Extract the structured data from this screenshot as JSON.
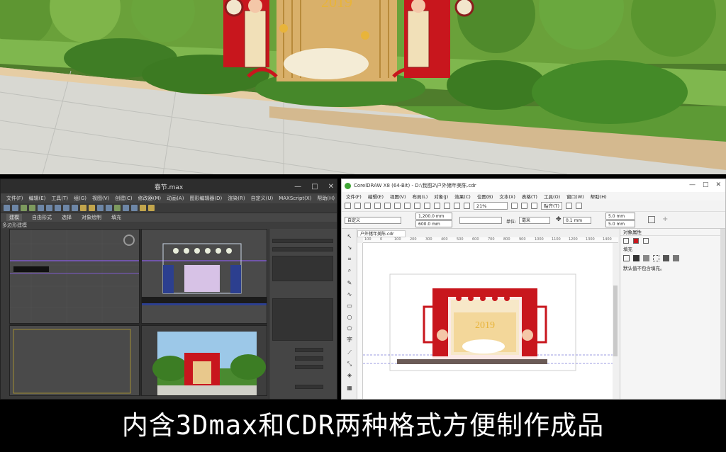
{
  "caption": "内含3Dmax和CDR两种格式方便制作成品",
  "max_window": {
    "title": "春节.max",
    "window_buttons": [
      "—",
      "□",
      "✕"
    ],
    "menu": [
      "文件(F)",
      "编辑(E)",
      "工具(T)",
      "组(G)",
      "视图(V)",
      "创建(C)",
      "修改器(M)",
      "动画(A)",
      "图形编辑器(D)",
      "渲染(R)",
      "自定义(U)",
      "MAXScript(X)",
      "帮助(H)"
    ],
    "ribbon_tabs": [
      "建模",
      "自由形式",
      "选择",
      "对象绘制",
      "填充"
    ],
    "active_ribbon_tab": "建模",
    "sub_label": "多边形建模"
  },
  "cdr_window": {
    "title": "CorelDRAW X8 (64-Bit) - D:\\我图2\\户外猪年美陈.cdr",
    "menu": [
      "文件(F)",
      "编辑(E)",
      "视图(V)",
      "布局(L)",
      "对象(J)",
      "效果(C)",
      "位图(B)",
      "文本(X)",
      "表格(T)",
      "工具(O)",
      "窗口(W)",
      "帮助(H)"
    ],
    "zoom": "21%",
    "snap_label": "贴齐(T)",
    "preset": "自定义",
    "width_value": "1,200.0 mm",
    "height_value": "600.0 mm",
    "unit_label": "单位:",
    "unit_value": "毫米",
    "nudge_value": "0.1 mm",
    "dup_x": "5.0 mm",
    "dup_y": "5.0 mm",
    "doc_tab": "户外猪年美陈.cdr",
    "ruler_ticks": [
      "100",
      "0",
      "100",
      "200",
      "300",
      "400",
      "500",
      "600",
      "700",
      "800",
      "900",
      "1000",
      "1100",
      "1200",
      "1300",
      "1400"
    ],
    "panel_title": "对象属性",
    "panel_section": "填充",
    "panel_note": "默认值不包含填充。"
  },
  "colors": {
    "festival_red": "#c8161d",
    "gold": "#e8b43a",
    "max_bg": "#3b3b3b",
    "cdr_bg": "#f0f0f0"
  }
}
